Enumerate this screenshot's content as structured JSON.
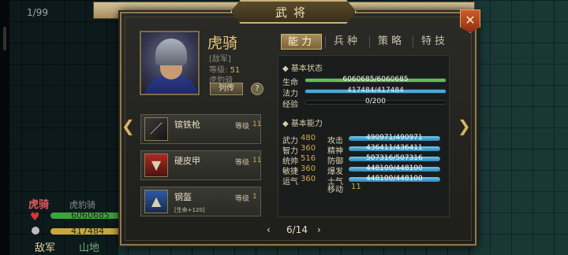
{
  "hud": {
    "page_counter": "1/99"
  },
  "unit_info": {
    "name": "虎骑",
    "type": "虎豹骑",
    "hp_value": "6060685",
    "mp_value": "417484",
    "faction": "敌军",
    "terrain": "山地"
  },
  "dialog": {
    "title": "武将",
    "close_icon": "close-x-icon"
  },
  "general": {
    "name": "虎骑",
    "faction": "[敌军]",
    "level_label": "等级:",
    "level_value": "51",
    "troop_type": "虎豹骑",
    "bio_button": "列传",
    "help_button": "?"
  },
  "tabs": [
    {
      "label": "能力",
      "active": true
    },
    {
      "label": "兵种",
      "active": false
    },
    {
      "label": "策略",
      "active": false
    },
    {
      "label": "特技",
      "active": false
    }
  ],
  "basic_status": {
    "heading": "基本状态",
    "hp_label": "生命",
    "hp_text": "6060685/6060685",
    "hp_fraction": 1.0,
    "mp_label": "法力",
    "mp_text": "417484/417484",
    "mp_fraction": 1.0,
    "exp_label": "经验",
    "exp_text": "0/200",
    "exp_fraction": 0.0
  },
  "basic_ability": {
    "heading": "基本能力",
    "stats": [
      {
        "label": "武力",
        "value": "480"
      },
      {
        "label": "智力",
        "value": "360"
      },
      {
        "label": "统帅",
        "value": "516"
      },
      {
        "label": "敏捷",
        "value": "360"
      },
      {
        "label": "运气",
        "value": "360"
      }
    ],
    "derived": [
      {
        "label": "攻击",
        "text": "490971/490971"
      },
      {
        "label": "精神",
        "text": "436411/436411"
      },
      {
        "label": "防御",
        "text": "507316/507316"
      },
      {
        "label": "爆发",
        "text": "448100/448100"
      },
      {
        "label": "士气",
        "text": "448100/448100"
      }
    ],
    "move_label": "移动",
    "move_value": "11"
  },
  "equipment": [
    {
      "name": "镔铁枪",
      "level_label": "等级",
      "level_value": "11",
      "sub": "",
      "icon": "spear-icon"
    },
    {
      "name": "硬皮甲",
      "level_label": "等级",
      "level_value": "11",
      "sub": "",
      "icon": "armor-icon"
    },
    {
      "name": "钢盔",
      "level_label": "等级",
      "level_value": "1",
      "sub": "[生命+120]",
      "icon": "helmet-icon"
    }
  ],
  "pager": {
    "text": "6/14",
    "prev": "‹",
    "next": "›"
  },
  "nav": {
    "left_arrow": "❮",
    "right_arrow": "❯"
  },
  "colors": {
    "hp_bar": "#5cc24a",
    "mp_bar": "#4da7d8",
    "accent_gold": "#d1a848"
  }
}
